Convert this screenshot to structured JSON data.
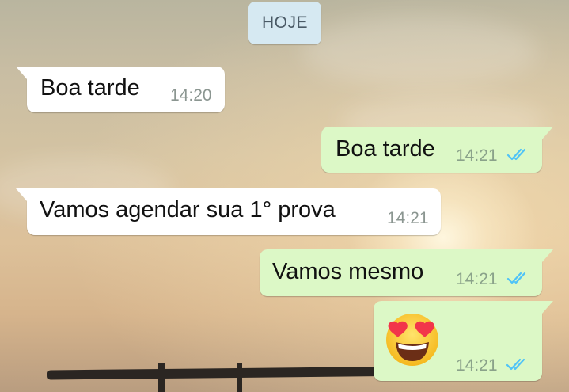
{
  "date_divider": "HOJE",
  "messages": [
    {
      "direction": "incoming",
      "text": "Boa tarde",
      "time": "14:20"
    },
    {
      "direction": "outgoing",
      "text": "Boa tarde",
      "time": "14:21",
      "status": "read"
    },
    {
      "direction": "incoming",
      "text": "Vamos agendar sua 1° prova",
      "time": "14:21"
    },
    {
      "direction": "outgoing",
      "text": "Vamos mesmo",
      "time": "14:21",
      "status": "read"
    },
    {
      "direction": "outgoing",
      "emoji": "smiling-face-with-heart-eyes",
      "time": "14:21",
      "status": "read"
    }
  ],
  "colors": {
    "incoming_bubble": "#ffffff",
    "outgoing_bubble": "#dcf8c6",
    "read_ticks": "#4fc3f7",
    "date_chip": "#d6e9f2"
  },
  "icons": {
    "read_receipt": "double-check-icon"
  }
}
